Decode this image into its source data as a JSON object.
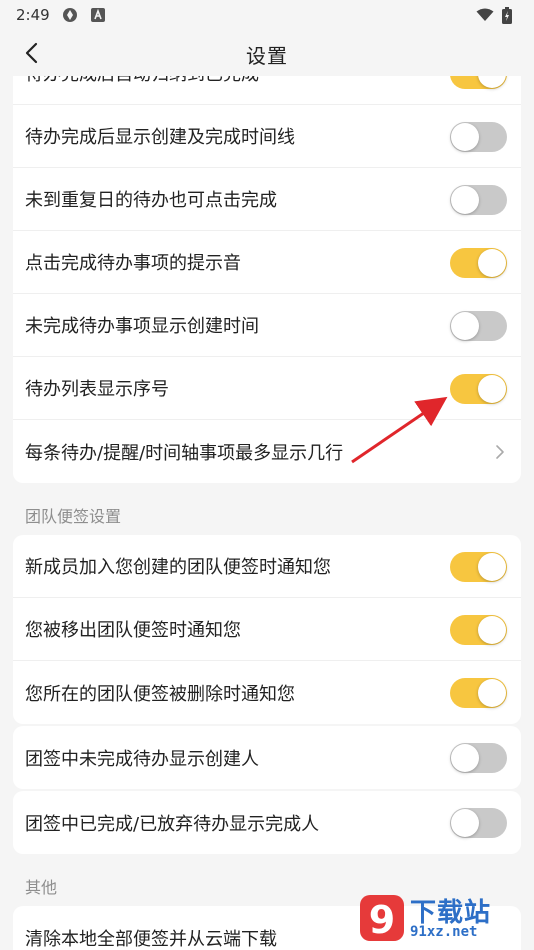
{
  "status": {
    "time": "2:49"
  },
  "nav": {
    "title": "设置"
  },
  "card1": {
    "items": [
      {
        "label": "待办完成后自动归纳到已完成",
        "toggle": "on"
      },
      {
        "label": "待办完成后显示创建及完成时间线",
        "toggle": "off"
      },
      {
        "label": "未到重复日的待办也可点击完成",
        "toggle": "off"
      },
      {
        "label": "点击完成待办事项的提示音",
        "toggle": "on"
      },
      {
        "label": "未完成待办事项显示创建时间",
        "toggle": "off"
      },
      {
        "label": "待办列表显示序号",
        "toggle": "on"
      },
      {
        "label": "每条待办/提醒/时间轴事项最多显示几行"
      }
    ]
  },
  "section_team": {
    "title": "团队便签设置"
  },
  "card2": {
    "items": [
      {
        "label": "新成员加入您创建的团队便签时通知您",
        "toggle": "on"
      },
      {
        "label": "您被移出团队便签时通知您",
        "toggle": "on"
      },
      {
        "label": "您所在的团队便签被删除时通知您",
        "toggle": "on"
      }
    ]
  },
  "card3": {
    "items": [
      {
        "label": "团签中未完成待办显示创建人",
        "toggle": "off"
      }
    ]
  },
  "card4": {
    "items": [
      {
        "label": "团签中已完成/已放弃待办显示完成人",
        "toggle": "off"
      }
    ]
  },
  "section_other": {
    "title": "其他"
  },
  "card5": {
    "items": [
      {
        "label": "清除本地全部便签并从云端下载"
      }
    ]
  },
  "watermark": {
    "brand": "下载站",
    "url": "91xz.net",
    "logo_text": "9"
  },
  "colors": {
    "toggle_on": "#f7c640",
    "toggle_off": "#c9c9c9",
    "annotation_arrow": "#e0262b"
  }
}
